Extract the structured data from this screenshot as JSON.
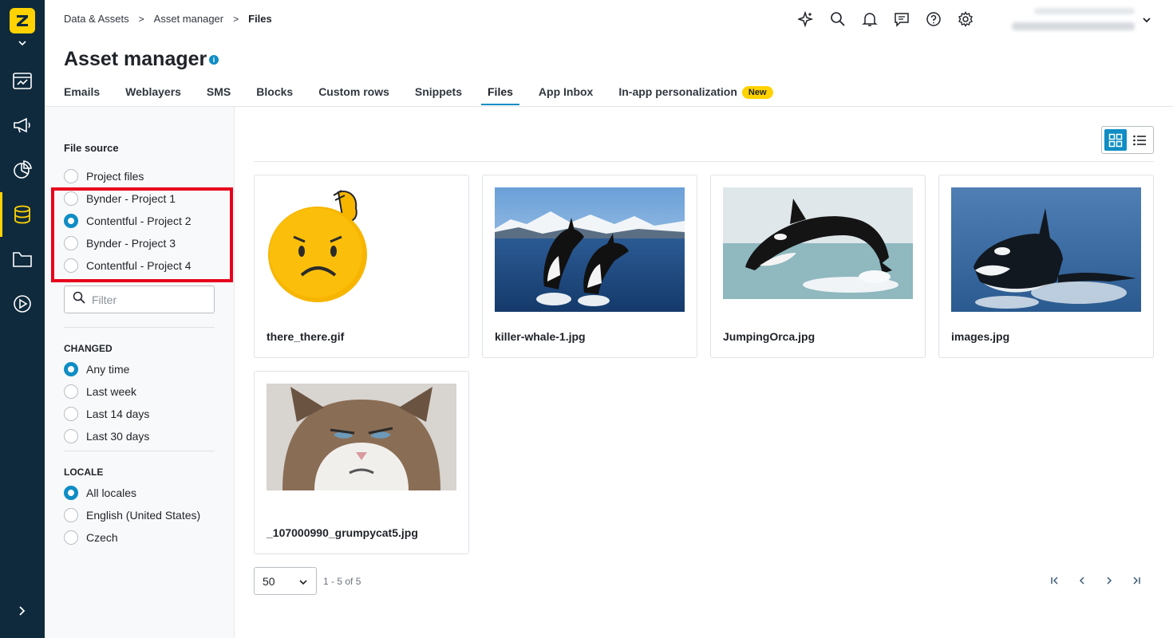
{
  "breadcrumb": {
    "items": [
      "Data & Assets",
      "Asset manager"
    ],
    "current": "Files",
    "separator": ">"
  },
  "header": {
    "title": "Asset manager",
    "info_glyph": "i"
  },
  "tabs": [
    {
      "label": "Emails"
    },
    {
      "label": "Weblayers"
    },
    {
      "label": "SMS"
    },
    {
      "label": "Blocks"
    },
    {
      "label": "Custom rows"
    },
    {
      "label": "Snippets"
    },
    {
      "label": "Files",
      "active": true
    },
    {
      "label": "App Inbox"
    },
    {
      "label": "In-app personalization",
      "badge": "New"
    }
  ],
  "sidebar": {
    "file_source": {
      "title": "File source",
      "options": [
        "Project files",
        "Bynder - Project 1",
        "Contentful - Project 2",
        "Bynder - Project 3",
        "Contentful - Project 4"
      ],
      "selected": "Contentful - Project 2"
    },
    "filter": {
      "placeholder": "Filter"
    },
    "changed": {
      "title": "CHANGED",
      "options": [
        "Any time",
        "Last week",
        "Last 14 days",
        "Last 30 days"
      ],
      "selected": "Any time"
    },
    "locale": {
      "title": "LOCALE",
      "options": [
        "All locales",
        "English (United States)",
        "Czech"
      ],
      "selected": "All locales"
    }
  },
  "files": [
    {
      "name": "there_there.gif",
      "thumb": "sad-emoji"
    },
    {
      "name": "killer-whale-1.jpg",
      "thumb": "two-orcas-mountains"
    },
    {
      "name": "JumpingOrca.jpg",
      "thumb": "jumping-orca"
    },
    {
      "name": "images.jpg",
      "thumb": "orca-splash"
    },
    {
      "name": "_107000990_grumpycat5.jpg",
      "thumb": "grumpy-cat"
    }
  ],
  "pagination": {
    "page_size": "50",
    "range": "1 - 5 of 5"
  },
  "view_mode": "grid",
  "colors": {
    "rail": "#0f2a3d",
    "accent": "#0f8dc4",
    "brand_yellow": "#ffd200",
    "highlight": "#e8001c"
  },
  "icons": {
    "rail": [
      "logo",
      "campaigns-icon",
      "megaphone-icon",
      "analytics-icon",
      "database-icon",
      "folder-icon",
      "play-icon",
      "expand-icon"
    ],
    "top": [
      "sparkle-icon",
      "search-icon",
      "bell-icon",
      "chat-icon",
      "help-icon",
      "gear-icon"
    ]
  }
}
